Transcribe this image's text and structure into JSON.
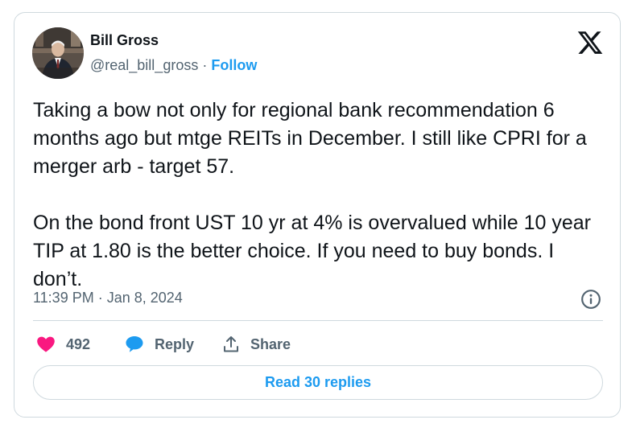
{
  "author": {
    "name": "Bill Gross",
    "handle": "@real_bill_gross",
    "separator": "·",
    "follow_label": "Follow"
  },
  "tweet": {
    "paragraphs": [
      "Taking a bow not only for regional bank recommendation 6 months ago but mtge REITs in December. I still like CPRI for a merger arb - target 57.",
      "On the bond front UST 10 yr at 4% is overvalued while 10 year TIP at 1.80 is the better choice. If you need to buy bonds. I don’t."
    ],
    "timestamp": "11:39 PM · Jan 8, 2024"
  },
  "actions": {
    "like_count": "492",
    "reply_label": "Reply",
    "share_label": "Share"
  },
  "read_replies_label": "Read 30 replies",
  "icons": {
    "logo": "x-logo-icon",
    "info": "info-icon",
    "like": "heart-icon",
    "reply": "speech-bubble-icon",
    "share": "share-icon"
  },
  "colors": {
    "accent": "#1d9bf0",
    "like": "#f91880",
    "text": "#0f1419",
    "muted": "#536471",
    "border": "#cfd9de"
  }
}
